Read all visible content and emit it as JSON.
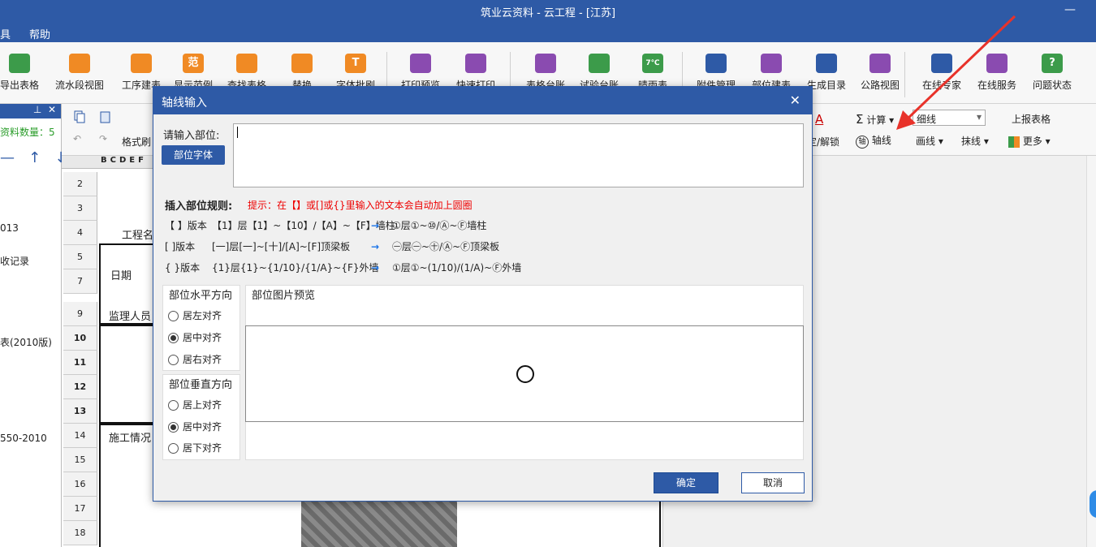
{
  "app": {
    "title": "筑业云资料 - 云工程 - [江苏]"
  },
  "menu": {
    "items": [
      "具",
      "帮助"
    ]
  },
  "ribbon": {
    "buttons": [
      {
        "label": "导出表格",
        "icon": "export-icon",
        "color": "#3c9b4a"
      },
      {
        "label": "流水段视图",
        "icon": "flow-segment-icon",
        "color": "#f08a24"
      },
      {
        "label": "工序建表",
        "icon": "process-icon",
        "color": "#f08a24"
      },
      {
        "label": "显示范例",
        "icon": "example-icon",
        "color": "#f08a24",
        "glyph": "范"
      },
      {
        "label": "查找表格",
        "icon": "find-table-icon",
        "color": "#f08a24"
      },
      {
        "label": "替换",
        "icon": "replace-icon",
        "color": "#f08a24"
      },
      {
        "label": "字体批刷",
        "icon": "font-brush-icon",
        "color": "#f08a24",
        "glyph": "T"
      },
      {
        "label": "打印预览",
        "icon": "print-preview-icon",
        "color": "#8a4bb0"
      },
      {
        "label": "快速打印",
        "icon": "quick-print-icon",
        "color": "#8a4bb0"
      },
      {
        "label": "表格台账",
        "icon": "table-ledger-icon",
        "color": "#8a4bb0"
      },
      {
        "label": "试验台账",
        "icon": "test-ledger-icon",
        "color": "#3c9b4a"
      },
      {
        "label": "晴雨表",
        "icon": "weather-icon",
        "color": "#3c9b4a",
        "glyph": "7℃"
      },
      {
        "label": "附件管理",
        "icon": "attachment-icon",
        "color": "#2e5aa6"
      },
      {
        "label": "部位建表",
        "icon": "location-table-icon",
        "color": "#8a4bb0"
      },
      {
        "label": "生成目录",
        "icon": "catalog-icon",
        "color": "#2e5aa6"
      },
      {
        "label": "公路视图",
        "icon": "highway-icon",
        "color": "#8a4bb0"
      },
      {
        "label": "在线专家",
        "icon": "expert-icon",
        "color": "#2e5aa6"
      },
      {
        "label": "在线服务",
        "icon": "service-icon",
        "color": "#8a4bb0"
      },
      {
        "label": "问题状态",
        "icon": "question-icon",
        "color": "#3c9b4a",
        "glyph": "?"
      }
    ]
  },
  "toolbar2": {
    "format_brush": "格式刷",
    "calc": "计算",
    "line_style": "细线",
    "report": "上报表格",
    "lock_unlock": "定/解锁",
    "axis": "轴线",
    "axis_glyph": "轴",
    "draw_line": "画线",
    "erase_line": "抹线",
    "more": "更多"
  },
  "left_panel": {
    "count_label": "资料数量：5",
    "items": [
      "013",
      "收记录",
      "表(2010版)",
      "550-2010"
    ]
  },
  "sheet": {
    "col_headers": "BCDEF",
    "rows": [
      "2",
      "3",
      "4",
      "5",
      "7",
      "9",
      "10",
      "11",
      "12",
      "13",
      "14",
      "15",
      "16",
      "17",
      "18"
    ],
    "project_name": "工程名",
    "date": "日期",
    "supervisor": "监理人员",
    "construction": "施工情况"
  },
  "dialog": {
    "title": "轴线输入",
    "input_label": "请输入部位:",
    "font_button": "部位字体",
    "input_value": "",
    "rules_title": "插入部位规则:",
    "rules_hint": "提示：在【】或[]或{}里输入的文本会自动加上圆圈",
    "rules": [
      {
        "version": "【 】版本",
        "input": "【1】层【1】~【10】/【A】~【F】墙柱",
        "arrow": "→",
        "output": "①层①~⑩/Ⓐ~Ⓕ墙柱"
      },
      {
        "version": "[ ]版本",
        "input": "[一]层[一]~[十]/[A]~[F]顶梁板",
        "arrow": "→",
        "output": "㊀层㊀~㊉/Ⓐ~Ⓕ顶梁板"
      },
      {
        "version": "{ }版本",
        "input": "{1}层{1}~{1/10}/{1/A}~{F}外墙",
        "arrow": "→",
        "output": "①层①~(1/10)/(1/A)~Ⓕ外墙"
      }
    ],
    "h_align": {
      "title": "部位水平方向",
      "options": [
        "居左对齐",
        "居中对齐",
        "居右对齐"
      ],
      "selected": 1
    },
    "v_align": {
      "title": "部位垂直方向",
      "options": [
        "居上对齐",
        "居中对齐",
        "居下对齐"
      ],
      "selected": 1
    },
    "preview_title": "部位图片预览",
    "ok": "确定",
    "cancel": "取消"
  }
}
